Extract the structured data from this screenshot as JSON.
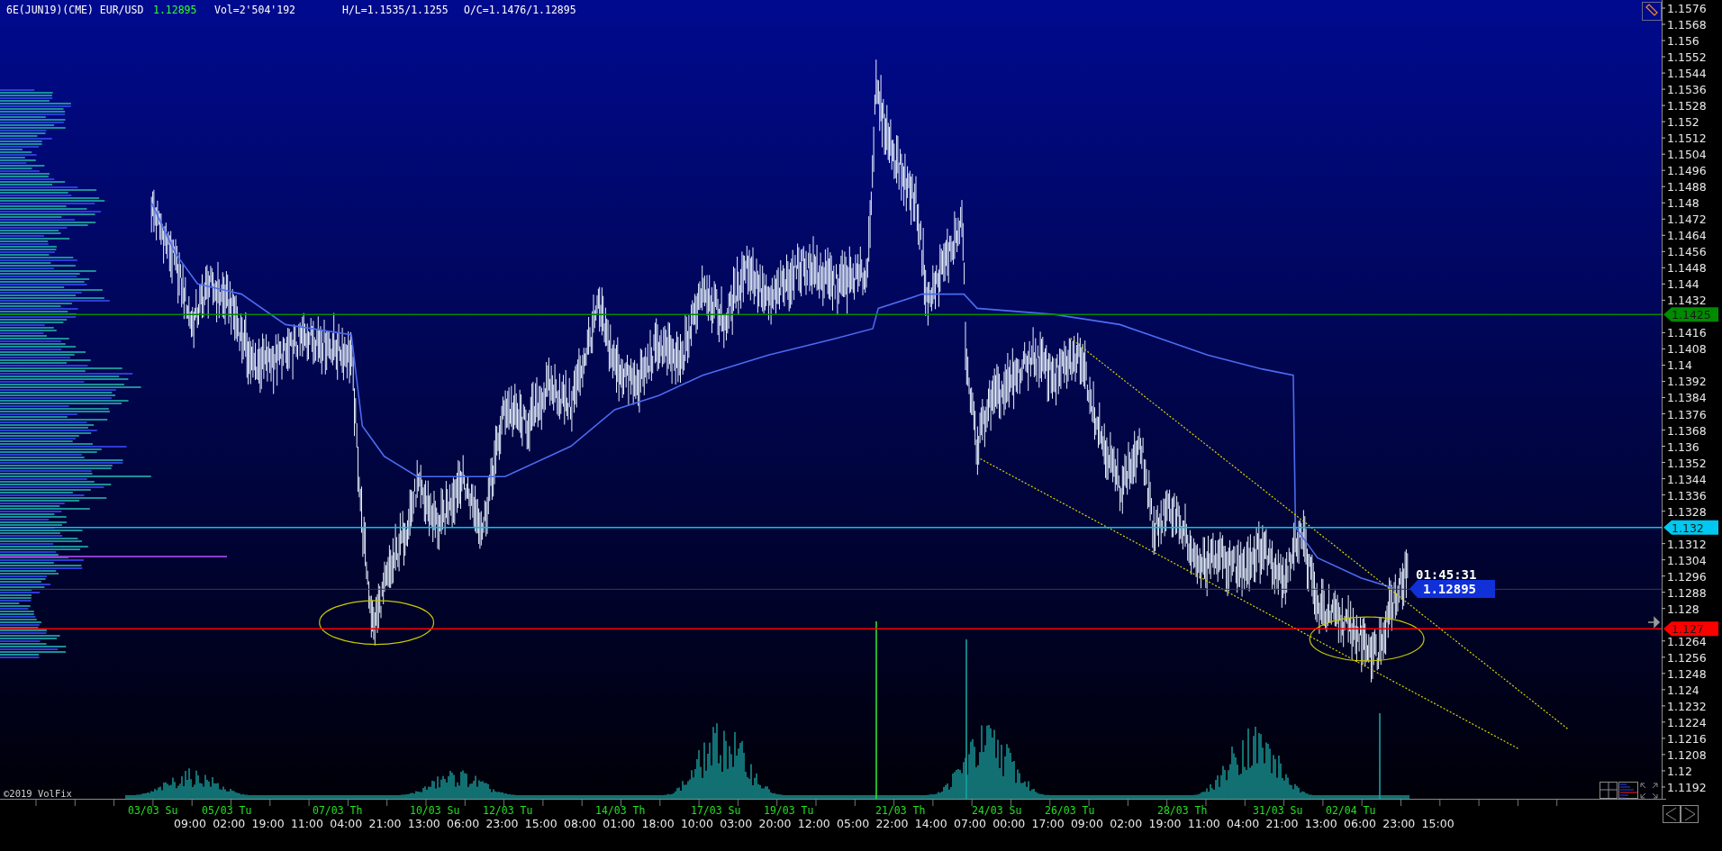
{
  "header": {
    "symbol": "6E(JUN19)(CME) EUR/USD",
    "last_price": "1.12895",
    "volume": "Vol=2'504'192",
    "high_low": "H/L=1.1535/1.1255",
    "open_close": "O/C=1.1476/1.12895"
  },
  "price_axis": {
    "labels": [
      "1.1576",
      "1.1568",
      "1.156",
      "1.1552",
      "1.1544",
      "1.1536",
      "1.1528",
      "1.152",
      "1.1512",
      "1.1504",
      "1.1496",
      "1.1488",
      "1.148",
      "1.1472",
      "1.1464",
      "1.1456",
      "1.1448",
      "1.144",
      "1.1432",
      "1.1416",
      "1.1408",
      "1.14",
      "1.1392",
      "1.1384",
      "1.1376",
      "1.1368",
      "1.136",
      "1.1352",
      "1.1344",
      "1.1336",
      "1.1328",
      "1.1312",
      "1.1304",
      "1.1296",
      "1.1288",
      "1.128",
      "1.1264",
      "1.1256",
      "1.1248",
      "1.124",
      "1.1232",
      "1.1224",
      "1.1216",
      "1.1208",
      "1.12",
      "1.1192"
    ]
  },
  "level_lines": [
    {
      "label": "1.1425",
      "color": "#008a00"
    },
    {
      "label": "1.132",
      "color": "#00c8f0"
    },
    {
      "label": "1.127",
      "color": "#ff0000"
    }
  ],
  "current_price": {
    "timer": "01:45:31",
    "price": "1.12895"
  },
  "time_axis": {
    "dates": [
      "03/03 Su",
      "05/03 Tu",
      "07/03 Th",
      "10/03 Su",
      "12/03 Tu",
      "14/03 Th",
      "17/03 Su",
      "19/03 Tu",
      "21/03 Th",
      "24/03 Su",
      "26/03 Tu",
      "28/03 Th",
      "31/03 Su",
      "02/04 Tu"
    ],
    "times": [
      "09:00",
      "02:00",
      "19:00",
      "11:00",
      "04:00",
      "21:00",
      "13:00",
      "06:00",
      "23:00",
      "15:00",
      "08:00",
      "01:00",
      "18:00",
      "10:00",
      "03:00",
      "20:00",
      "12:00",
      "05:00",
      "22:00",
      "14:00",
      "07:00",
      "00:00",
      "17:00",
      "09:00",
      "02:00",
      "19:00",
      "11:00",
      "04:00",
      "21:00",
      "13:00",
      "06:00",
      "23:00",
      "15:00"
    ]
  },
  "copyright": "©2019 VolFix"
}
